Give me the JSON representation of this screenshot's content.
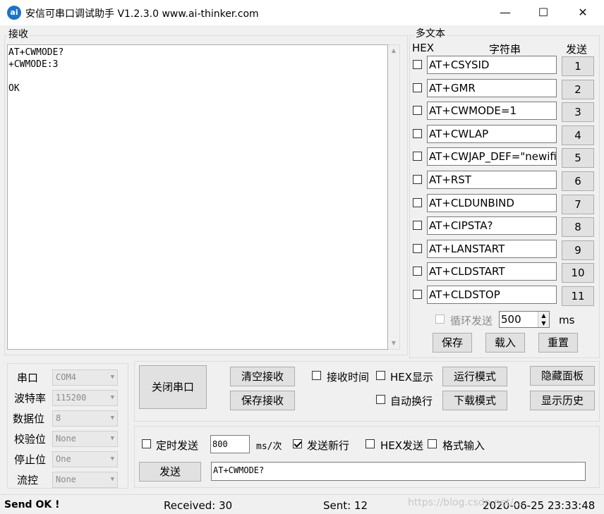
{
  "window": {
    "title": "安信可串口调试助手 V1.2.3.0    www.ai-thinker.com",
    "icon_text": "ai",
    "minimize": "—",
    "maximize": "☐",
    "close": "✕"
  },
  "receive": {
    "group_label": "接收",
    "text": "AT+CWMODE?\n+CWMODE:3\n\nOK"
  },
  "multi_text": {
    "group_label": "多文本",
    "col_hex": "HEX",
    "col_string": "字符串",
    "col_send": "发送",
    "rows": [
      {
        "hex": false,
        "text": "AT+CSYSID",
        "button": "1"
      },
      {
        "hex": false,
        "text": "AT+GMR",
        "button": "2"
      },
      {
        "hex": false,
        "text": "AT+CWMODE=1",
        "button": "3"
      },
      {
        "hex": false,
        "text": "AT+CWLAP",
        "button": "4"
      },
      {
        "hex": false,
        "text": "AT+CWJAP_DEF=\"newifi_",
        "button": "5"
      },
      {
        "hex": false,
        "text": "AT+RST",
        "button": "6"
      },
      {
        "hex": false,
        "text": "AT+CLDUNBIND",
        "button": "7"
      },
      {
        "hex": false,
        "text": "AT+CIPSTA?",
        "button": "8"
      },
      {
        "hex": false,
        "text": "AT+LANSTART",
        "button": "9"
      },
      {
        "hex": false,
        "text": "AT+CLDSTART",
        "button": "10"
      },
      {
        "hex": false,
        "text": "AT+CLDSTOP",
        "button": "11"
      }
    ],
    "loop_send_label": "循环发送",
    "loop_interval": "500",
    "loop_unit": "ms",
    "save_button": "保存",
    "load_button": "载入",
    "reset_button": "重置"
  },
  "port_settings": {
    "port_label": "串口",
    "port_value": "COM4",
    "baud_label": "波特率",
    "baud_value": "115200",
    "databits_label": "数据位",
    "databits_value": "8",
    "parity_label": "校验位",
    "parity_value": "None",
    "stopbits_label": "停止位",
    "stopbits_value": "One",
    "flow_label": "流控",
    "flow_value": "None"
  },
  "controls": {
    "close_port_button": "关闭串口",
    "clear_receive_button": "清空接收",
    "save_receive_button": "保存接收",
    "receive_time_label": "接收时间",
    "hex_display_label": "HEX显示",
    "run_mode_button": "运行模式",
    "hide_panel_button": "隐藏面板",
    "auto_wrap_label": "自动换行",
    "download_mode_button": "下载模式",
    "show_history_button": "显示历史"
  },
  "send": {
    "timed_send_label": "定时发送",
    "interval_value": "800",
    "interval_unit": "ms/次",
    "send_newline_label": "发送新行",
    "send_newline_checked": true,
    "hex_send_label": "HEX发送",
    "format_input_label": "格式输入",
    "send_button": "发送",
    "input_value": "AT+CWMODE?"
  },
  "status": {
    "message": "Send OK !",
    "received": "Received: 30",
    "sent": "Sent: 12",
    "datetime": "2020-06-25 23:33:48"
  },
  "watermark": "https://blog.csdn.net/..."
}
